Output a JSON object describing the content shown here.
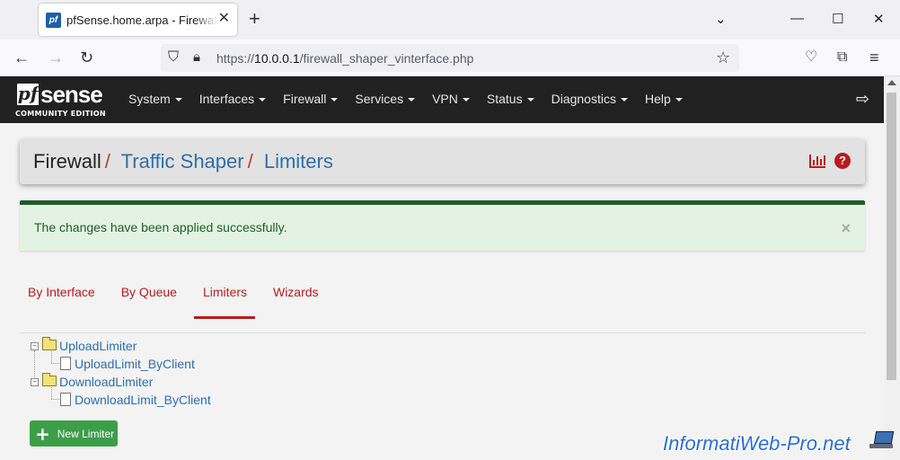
{
  "browser": {
    "tab_title": "pfSense.home.arpa - Firewall: Traffic Shaper: Limiters",
    "favicon_text": "pf",
    "url_prefix": "https://",
    "url_host": "10.0.0.1",
    "url_path": "/firewall_shaper_vinterface.php"
  },
  "logo": {
    "pf": "pf",
    "sense": "sense",
    "edition": "COMMUNITY EDITION"
  },
  "menu": [
    "System",
    "Interfaces",
    "Firewall",
    "Services",
    "VPN",
    "Status",
    "Diagnostics",
    "Help"
  ],
  "breadcrumb": {
    "root": "Firewall",
    "middle": "Traffic Shaper",
    "current": "Limiters",
    "separator": "/"
  },
  "alert": {
    "message": "The changes have been applied successfully.",
    "close": "×"
  },
  "tabs": [
    {
      "label": "By Interface",
      "active": false
    },
    {
      "label": "By Queue",
      "active": false
    },
    {
      "label": "Limiters",
      "active": true
    },
    {
      "label": "Wizards",
      "active": false
    }
  ],
  "tree": {
    "upload_limiter": "UploadLimiter",
    "upload_child": "UploadLimit_ByClient",
    "download_limiter": "DownloadLimiter",
    "download_child": "DownloadLimit_ByClient"
  },
  "buttons": {
    "new_limiter": "New Limiter"
  },
  "watermark": "InformatiWeb-Pro.net",
  "colors": {
    "header_bg": "#212121",
    "accent_red": "#b71c1c",
    "link_blue": "#2e6fac",
    "success_green": "#1e5e25",
    "button_green": "#3d9e48"
  }
}
